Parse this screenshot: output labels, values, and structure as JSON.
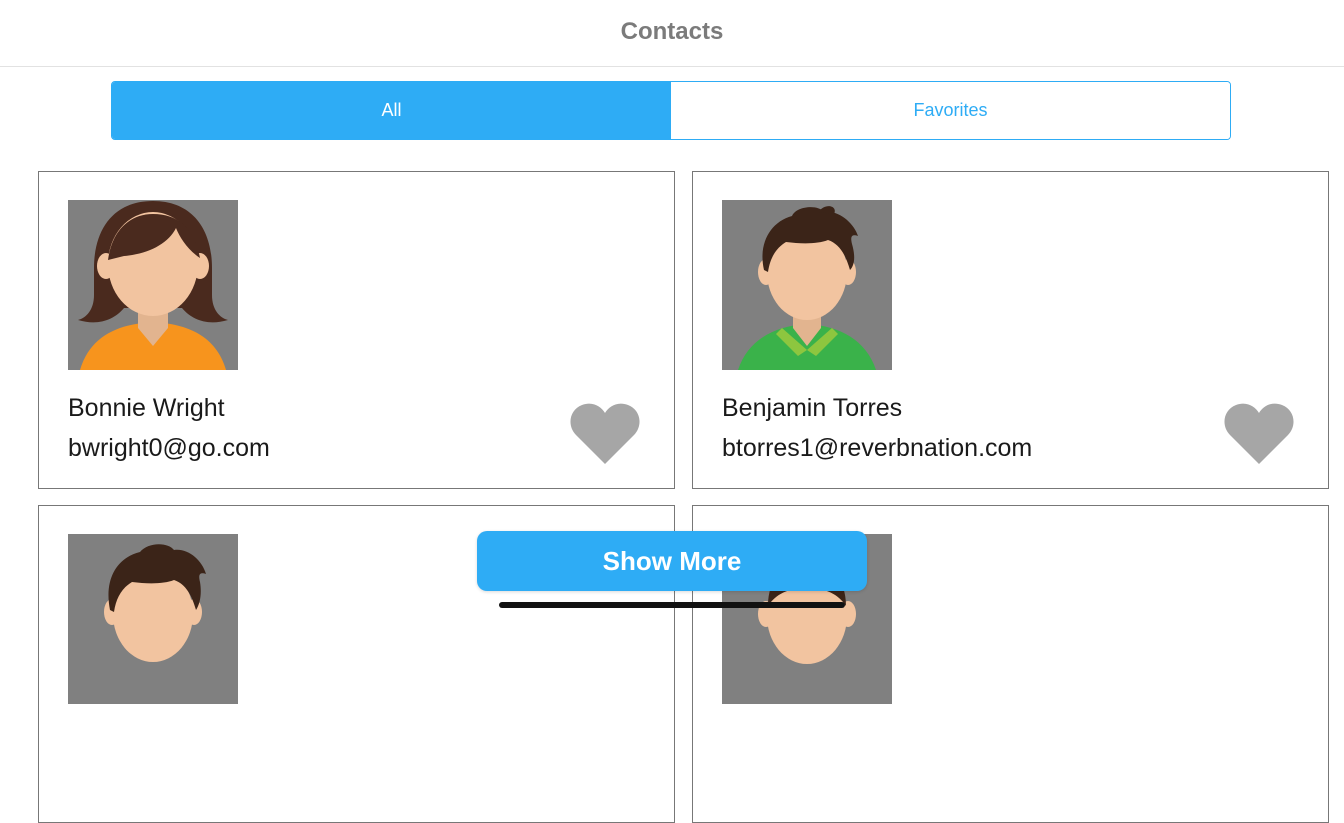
{
  "navbar": {
    "title": "Contacts"
  },
  "segments": [
    {
      "label": "All",
      "active": true
    },
    {
      "label": "Favorites",
      "active": false
    }
  ],
  "contacts": [
    {
      "name": "Bonnie Wright",
      "email": "bwright0@go.com",
      "favorite": false,
      "avatar": "female-avatar-orange-shirt"
    },
    {
      "name": "Benjamin Torres",
      "email": "btorres1@reverbnation.com",
      "favorite": false,
      "avatar": "male-avatar-green-shirt"
    },
    {
      "name": "",
      "email": "",
      "favorite": false,
      "avatar": "male-avatar"
    },
    {
      "name": "",
      "email": "",
      "favorite": false,
      "avatar": "avatar"
    }
  ],
  "actions": {
    "show_more_label": "Show More"
  },
  "colors": {
    "accent": "#2eacf5",
    "heart_inactive": "#a6a6a6",
    "avatar_bg": "#808080"
  }
}
